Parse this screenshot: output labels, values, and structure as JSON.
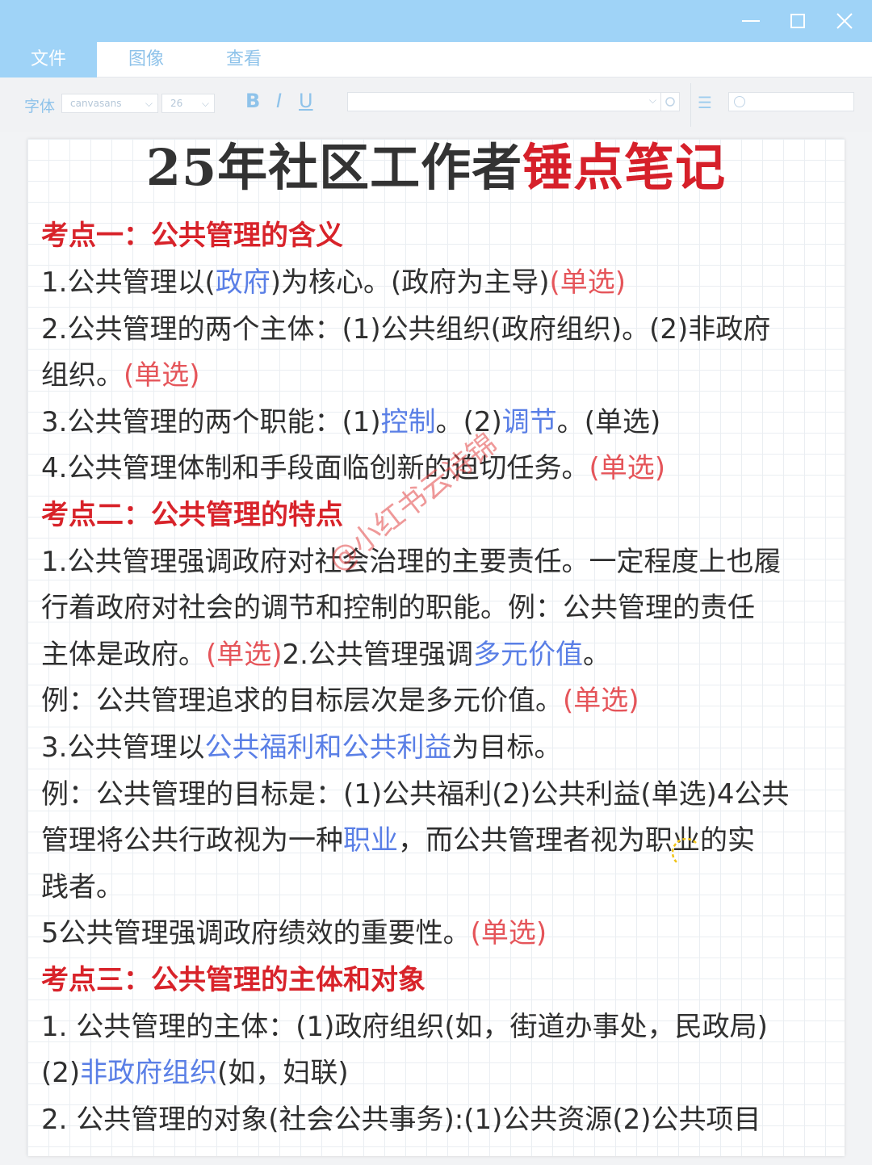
{
  "window": {
    "minimize_icon": "minimize-icon",
    "maximize_icon": "maximize-icon",
    "close_icon": "close-icon"
  },
  "menu": {
    "items": [
      {
        "label": "文件",
        "active": true
      },
      {
        "label": "图像",
        "active": false
      },
      {
        "label": "查看",
        "active": false
      }
    ]
  },
  "toolbar": {
    "font_label": "字体",
    "font_name": "canvasans",
    "font_size": "26",
    "bold": "B",
    "italic": "I",
    "underline": "U"
  },
  "doc": {
    "title_main": "25年社区工作者",
    "title_highlight": "锤点笔记",
    "watermark": "@小红书云诗锦",
    "s1": {
      "heading": "考点一：公共管理的含义",
      "l1a": "1.公共管理以(",
      "l1b": "政府",
      "l1c": ")为核心。(政府为主导)",
      "l1d": "(单选)",
      "l2a": "2.公共管理的两个主体：(1)公共组织(政府组织)。(2)非政府",
      "l3a": "组织。",
      "l3b": "(单选)",
      "l4a": "3.公共管理的两个职能：(1)",
      "l4b": "控制",
      "l4c": "。(2)",
      "l4d": "调节",
      "l4e": "。(单选)",
      "l5a": "4.公共管理体制和手段面临创新的迫切任务。",
      "l5b": "(单选)"
    },
    "s2": {
      "heading": "考点二：公共管理的特点",
      "l1": "1.公共管理强调政府对社会治理的主要责任。一定程度上也履",
      "l2": "行着政府对社会的调节和控制的职能。例：公共管理的责任",
      "l3a": "主体是政府。",
      "l3b": "(单选)",
      "l3c": "2.公共管理强调",
      "l3d": "多元价值",
      "l3e": "。",
      "l4a": "例：公共管理追求的目标层次是多元价值。",
      "l4b": "(单选)",
      "l5a": "3.公共管理以",
      "l5b": "公共福利和公共利益",
      "l5c": "为目标。",
      "l6": "例：公共管理的目标是：(1)公共福利(2)公共利益(单选)4公共",
      "l7a": "管理将公共行政视为一种",
      "l7b": "职业",
      "l7c": "，而公共管理者视为职业的实",
      "l8": "践者。",
      "l9a": "5公共管理强调政府绩效的重要性。",
      "l9b": "(单选)"
    },
    "s3": {
      "heading": "考点三：公共管理的主体和对象",
      "l1": "1. 公共管理的主体：(1)政府组织(如，街道办事处，民政局)",
      "l2a": "(2)",
      "l2b": "非政府组织",
      "l2c": "(如，妇联)",
      "l3": "2. 公共管理的对象(社会公共事务):(1)公共资源(2)公共项目"
    }
  }
}
